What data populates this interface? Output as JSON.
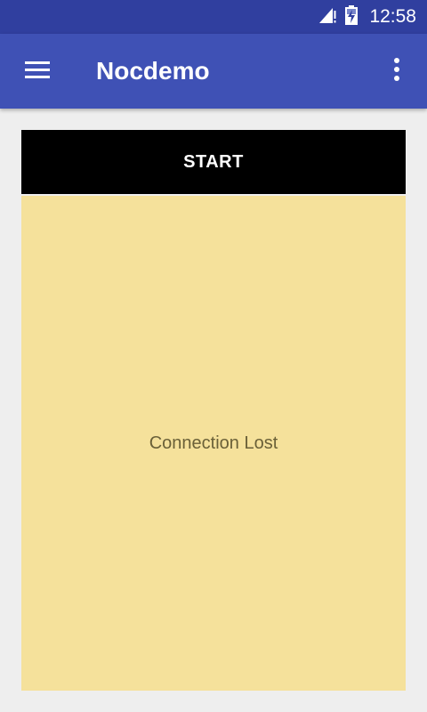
{
  "status_bar": {
    "time": "12:58",
    "icons": [
      "signal-icon",
      "battery-charging-icon"
    ]
  },
  "app_bar": {
    "title": "Nocdemo",
    "nav_icon": "hamburger-menu-icon",
    "overflow_icon": "more-vert-icon"
  },
  "main": {
    "start_label": "START",
    "message": "Connection Lost"
  },
  "colors": {
    "status_bar": "#303f9f",
    "app_bar": "#3f51b5",
    "background": "#eeeeee",
    "button": "#000000",
    "panel": "#f5e19b"
  }
}
